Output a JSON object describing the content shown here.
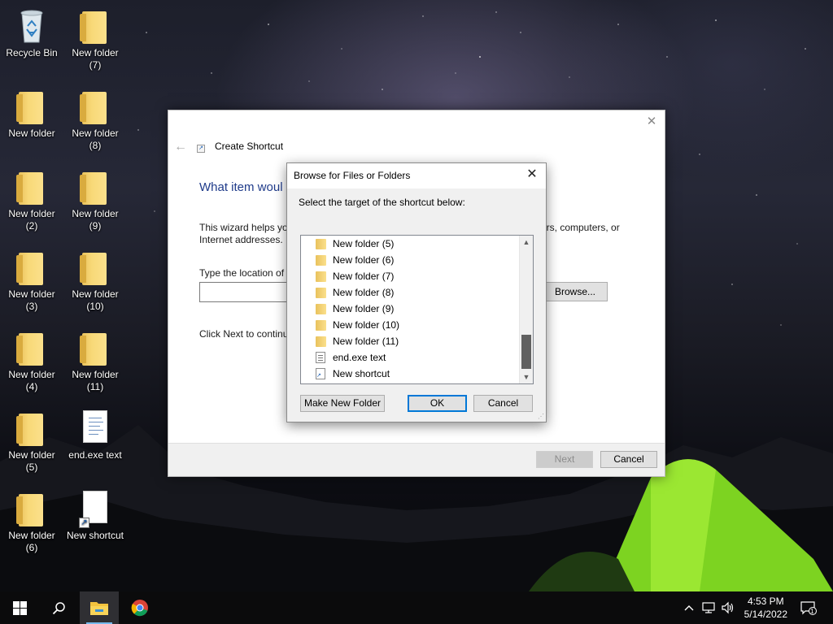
{
  "desktop": {
    "icons": [
      {
        "label": "Recycle Bin",
        "type": "recycle"
      },
      {
        "label": "New folder\n(7)",
        "type": "folder"
      },
      {
        "label": "New folder",
        "type": "folder"
      },
      {
        "label": "New folder\n(8)",
        "type": "folder"
      },
      {
        "label": "New folder\n(2)",
        "type": "folder"
      },
      {
        "label": "New folder\n(9)",
        "type": "folder"
      },
      {
        "label": "New folder\n(3)",
        "type": "folder"
      },
      {
        "label": "New folder\n(10)",
        "type": "folder"
      },
      {
        "label": "New folder\n(4)",
        "type": "folder"
      },
      {
        "label": "New folder\n(11)",
        "type": "folder"
      },
      {
        "label": "New folder\n(5)",
        "type": "folder"
      },
      {
        "label": "end.exe text",
        "type": "document"
      },
      {
        "label": "New folder\n(6)",
        "type": "folder"
      },
      {
        "label": "New shortcut",
        "type": "shortcut"
      }
    ]
  },
  "wizard": {
    "title": "Create Shortcut",
    "heading": "What item woul",
    "intro_line1_left": "This wizard helps you",
    "intro_line1_right": "ers, computers, or",
    "intro_line2": "Internet addresses.",
    "location_label": "Type the location of t",
    "location_value": "",
    "browse_label": "Browse...",
    "next_hint": "Click Next to continu",
    "next_label": "Next",
    "cancel_label": "Cancel"
  },
  "browse_dialog": {
    "title": "Browse for Files or Folders",
    "instruction": "Select the target of the shortcut below:",
    "items": [
      {
        "label": "New folder (5)",
        "icon": "folder-icon"
      },
      {
        "label": "New folder (6)",
        "icon": "folder-icon"
      },
      {
        "label": "New folder (7)",
        "icon": "folder-icon"
      },
      {
        "label": "New folder (8)",
        "icon": "folder-icon"
      },
      {
        "label": "New folder (9)",
        "icon": "folder-icon"
      },
      {
        "label": "New folder (10)",
        "icon": "folder-icon"
      },
      {
        "label": "New folder (11)",
        "icon": "folder-icon"
      },
      {
        "label": "end.exe text",
        "icon": "text-file-icon"
      },
      {
        "label": "New shortcut",
        "icon": "shortcut-file-icon"
      }
    ],
    "make_new_folder_label": "Make New Folder",
    "ok_label": "OK",
    "cancel_label": "Cancel"
  },
  "taskbar": {
    "time": "4:53 PM",
    "date": "5/14/2022",
    "notification_count": "1"
  },
  "colors": {
    "accent": "#0078d7",
    "heading_blue": "#1f3b8a",
    "taskbar": "#0b0b0c"
  }
}
